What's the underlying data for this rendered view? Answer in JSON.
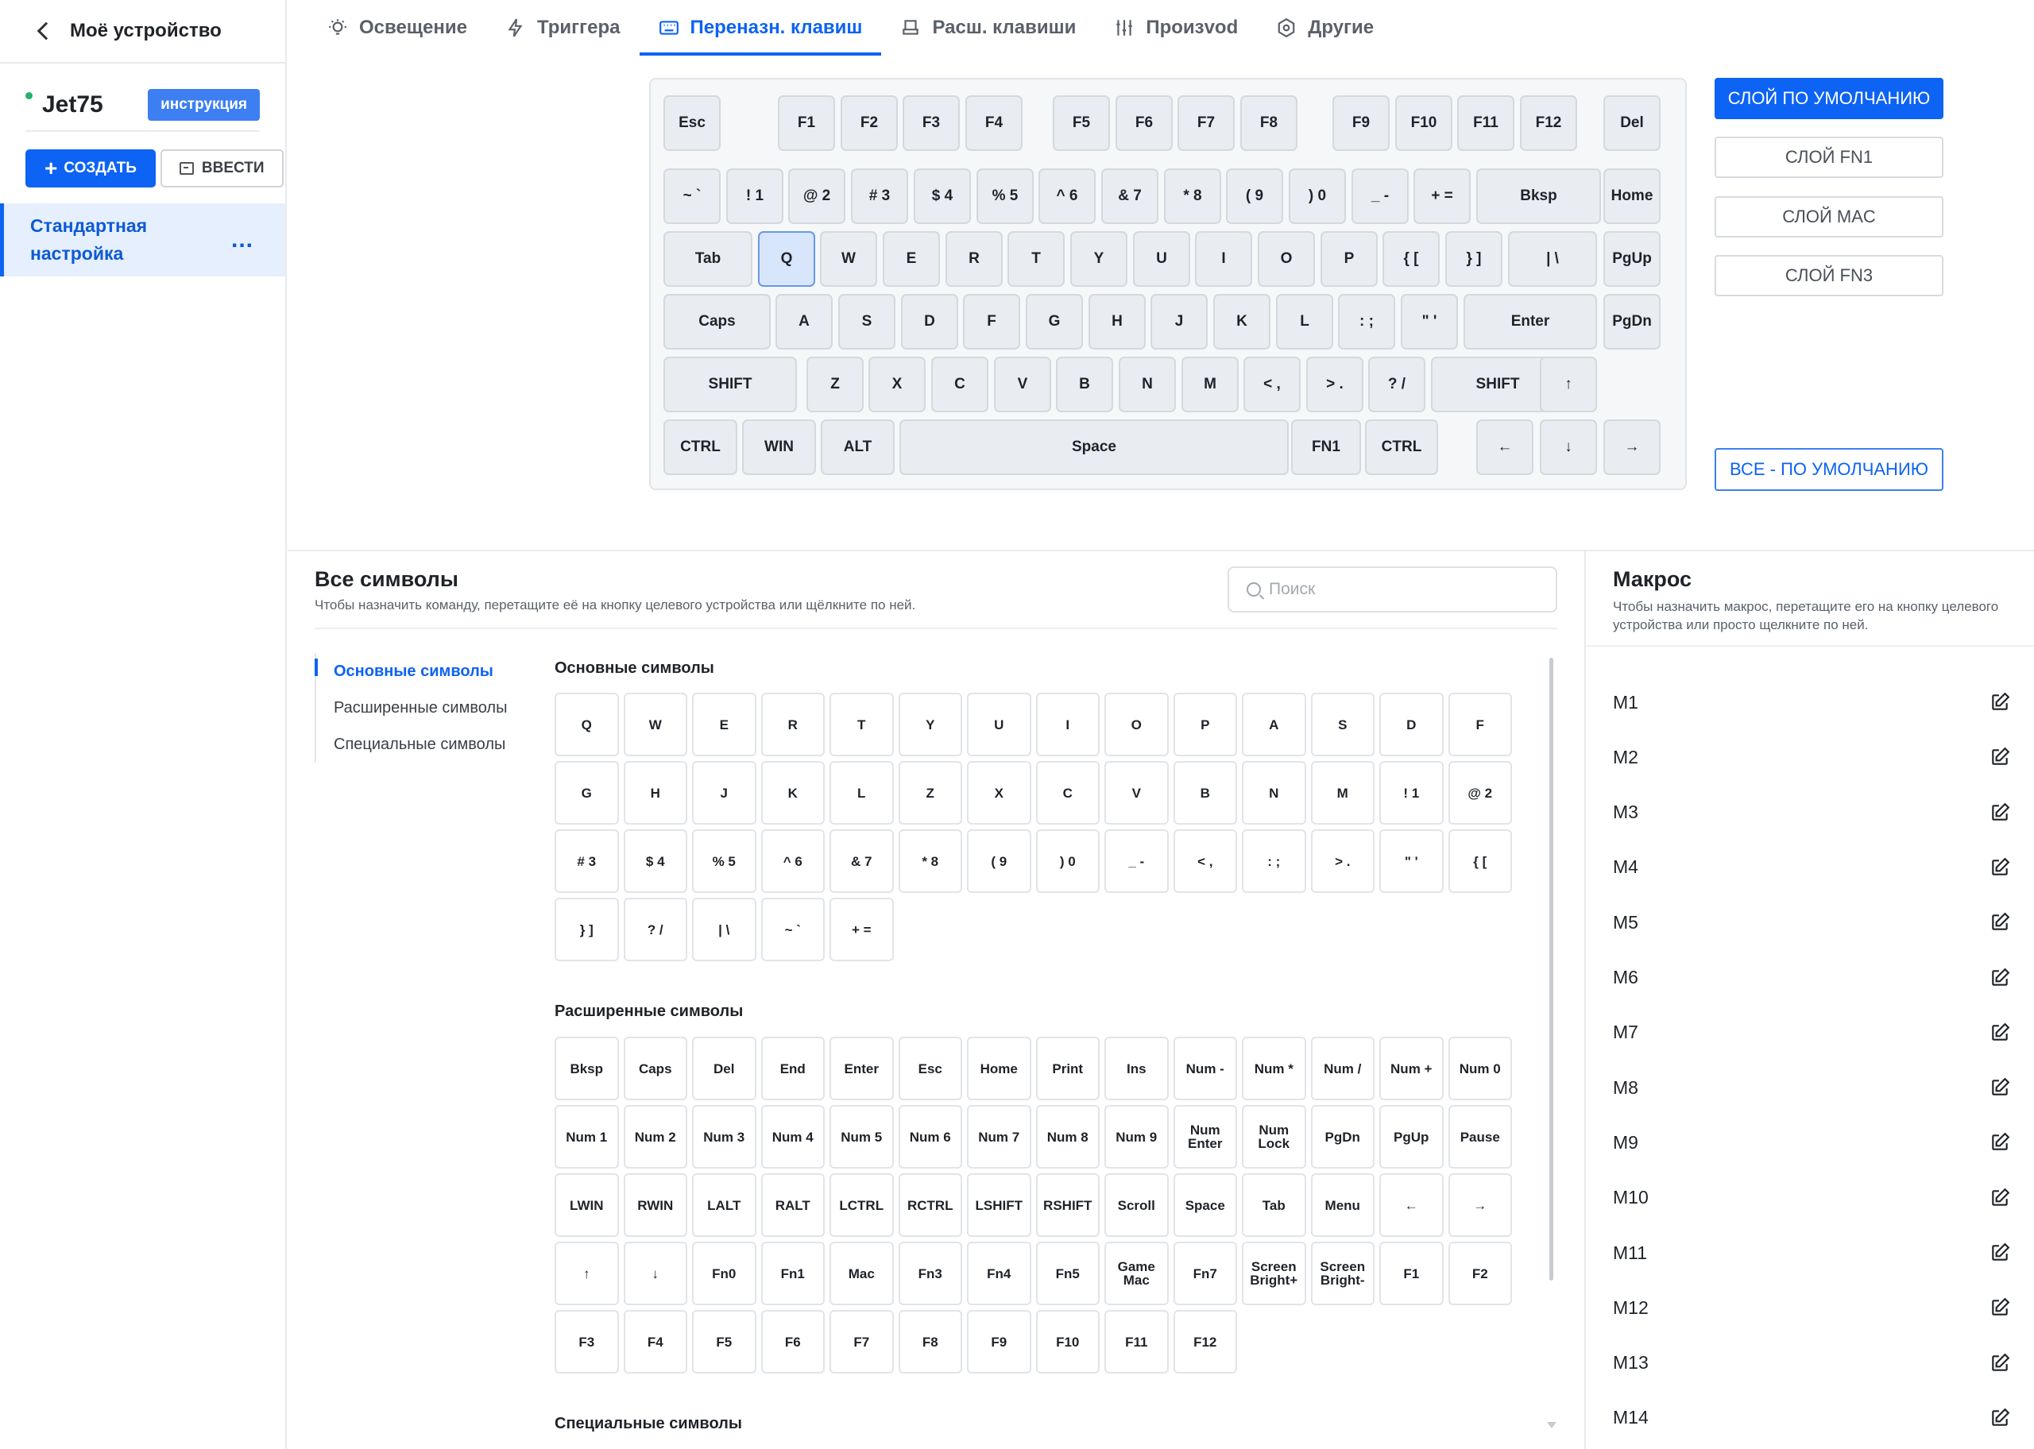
{
  "sidebar": {
    "back_label": "Моё устройство",
    "device_name": "Jet75",
    "manual_badge": "инструкция",
    "create_label": "СОЗДАТЬ",
    "import_label": "ВВЕСТИ",
    "profile_name": "Стандартная настройка",
    "profile_menu": "..."
  },
  "tabs": [
    {
      "label": "Освещение",
      "icon": "bulb-icon"
    },
    {
      "label": "Триггера",
      "icon": "lightning-icon"
    },
    {
      "label": "Переназн. клавиш",
      "icon": "keyboard-icon",
      "active": true
    },
    {
      "label": "Расш. клавиши",
      "icon": "seat-icon"
    },
    {
      "label": "Произvod",
      "icon": "sliders-icon"
    },
    {
      "label": "Другие",
      "icon": "settings-hexagon-icon"
    }
  ],
  "keyboard": {
    "rows": [
      [
        "Esc",
        "F1",
        "F2",
        "F3",
        "F4",
        "F5",
        "F6",
        "F7",
        "F8",
        "F9",
        "F10",
        "F11",
        "F12",
        "Del"
      ],
      [
        "~ `",
        "! 1",
        "@ 2",
        "# 3",
        "$ 4",
        "% 5",
        "^ 6",
        "& 7",
        "* 8",
        "( 9",
        ") 0",
        "_ -",
        "+ =",
        "Bksp",
        "Home"
      ],
      [
        "Tab",
        "Q",
        "W",
        "E",
        "R",
        "T",
        "Y",
        "U",
        "I",
        "O",
        "P",
        "{ [",
        "} ]",
        "| \\",
        "PgUp"
      ],
      [
        "Caps",
        "A",
        "S",
        "D",
        "F",
        "G",
        "H",
        "J",
        "K",
        "L",
        ": ;",
        "\" '",
        "Enter",
        "PgDn"
      ],
      [
        "SHIFT",
        "Z",
        "X",
        "C",
        "V",
        "B",
        "N",
        "M",
        "< ,",
        "> .",
        "? /",
        "SHIFT",
        "↑"
      ],
      [
        "CTRL",
        "WIN",
        "ALT",
        "Space",
        "FN1",
        "CTRL",
        "←",
        "↓",
        "→"
      ]
    ],
    "selected": "Q"
  },
  "layers": {
    "items": [
      "СЛОЙ ПО УМОЛЧАНИЮ",
      "СЛОЙ FN1",
      "СЛОЙ MAC",
      "СЛОЙ FN3"
    ],
    "active_index": 0,
    "reset_all": "ВСЕ - ПО УМОЛЧАНИЮ"
  },
  "symbols": {
    "title": "Все символы",
    "subtitle": "Чтобы назначить команду, перетащите её на кнопку целевого устройства или щёлкните по ней.",
    "search_placeholder": "Поиск",
    "categories": [
      "Основные символы",
      "Расширенные символы",
      "Специальные символы"
    ],
    "active_category": 0,
    "basic_title": "Основные символы",
    "basic": [
      "Q",
      "W",
      "E",
      "R",
      "T",
      "Y",
      "U",
      "I",
      "O",
      "P",
      "A",
      "S",
      "D",
      "F",
      "G",
      "H",
      "J",
      "K",
      "L",
      "Z",
      "X",
      "C",
      "V",
      "B",
      "N",
      "M",
      "! 1",
      "@ 2",
      "# 3",
      "$ 4",
      "% 5",
      "^ 6",
      "& 7",
      "* 8",
      "( 9",
      ") 0",
      "_ -",
      "< ,",
      ": ;",
      "> .",
      "\" '",
      "{ [",
      "} ]",
      "? /",
      "| \\",
      "~ `",
      "+ ="
    ],
    "extended_title": "Расширенные символы",
    "extended": [
      "Bksp",
      "Caps",
      "Del",
      "End",
      "Enter",
      "Esc",
      "Home",
      "Print",
      "Ins",
      "Num -",
      "Num *",
      "Num /",
      "Num +",
      "Num 0",
      "Num 1",
      "Num 2",
      "Num 3",
      "Num 4",
      "Num 5",
      "Num 6",
      "Num 7",
      "Num 8",
      "Num 9",
      "Num Enter",
      "Num Lock",
      "PgDn",
      "PgUp",
      "Pause",
      "LWIN",
      "RWIN",
      "LALT",
      "RALT",
      "LCTRL",
      "RCTRL",
      "LSHIFT",
      "RSHIFT",
      "Scroll",
      "Space",
      "Tab",
      "Menu",
      "←",
      "→",
      "↑",
      "↓",
      "Fn0",
      "Fn1",
      "Mac",
      "Fn3",
      "Fn4",
      "Fn5",
      "Game Mac",
      "Fn7",
      "Screen Bright+",
      "Screen Bright-",
      "F1",
      "F2",
      "F3",
      "F4",
      "F5",
      "F6",
      "F7",
      "F8",
      "F9",
      "F10",
      "F11",
      "F12"
    ],
    "special_title": "Специальные символы"
  },
  "macro": {
    "title": "Макрос",
    "subtitle": "Чтобы назначить макрос, перетащите его на кнопку целевого устройства или просто щелкните по ней.",
    "items": [
      "M1",
      "M2",
      "M3",
      "M4",
      "M5",
      "M6",
      "M7",
      "M8",
      "M9",
      "M10",
      "M11",
      "M12",
      "M13",
      "M14"
    ]
  },
  "colors": {
    "accent": "#0d63f3",
    "key_bg": "#e9ecf0",
    "selected_key": "#d8e6fc"
  }
}
